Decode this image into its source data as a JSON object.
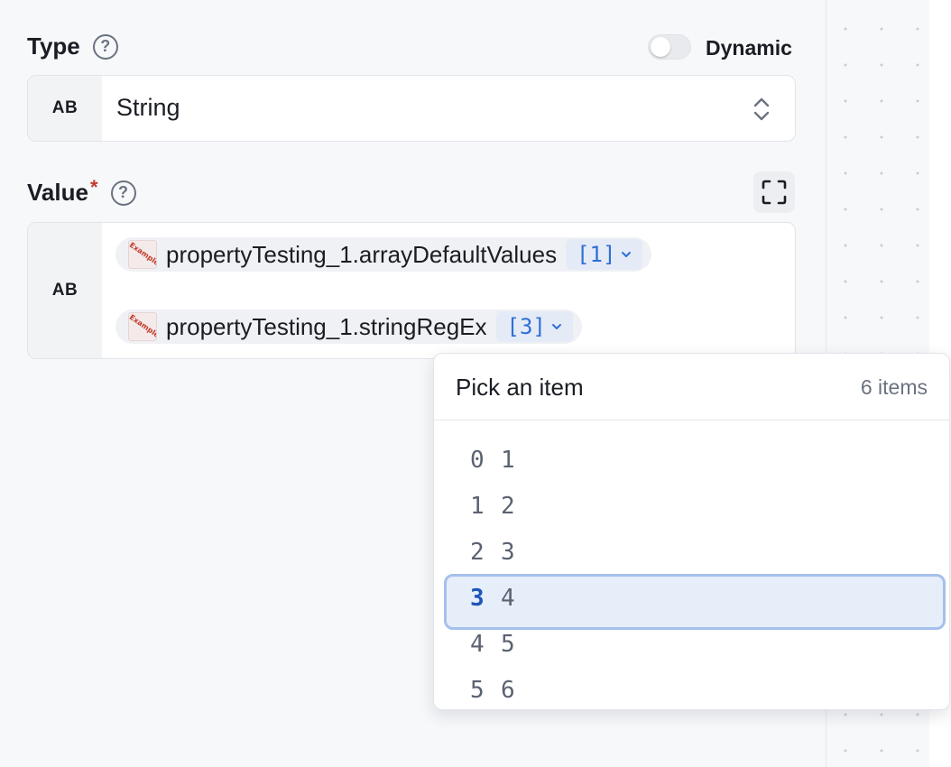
{
  "type_field": {
    "label": "Type",
    "dynamic_label": "Dynamic",
    "dynamic_on": false,
    "badge": "AB",
    "selected_value": "String"
  },
  "value_field": {
    "label": "Value",
    "required_mark": "*",
    "badge": "AB",
    "pills": [
      {
        "text": "propertyTesting_1.arrayDefaultValues",
        "index": "[1]"
      },
      {
        "text": "propertyTesting_1.stringRegEx",
        "index": "[3]"
      }
    ]
  },
  "icons": {
    "help": "help-circle-icon",
    "expand": "expand-icon",
    "select_chevron": "chevron-updown-icon",
    "pill_chevron": "chevron-down-icon",
    "thumb_stamp": "Example"
  },
  "dropdown": {
    "title": "Pick an item",
    "count": "6 items",
    "active_index": 3,
    "items": [
      {
        "index": "0",
        "value": "1"
      },
      {
        "index": "1",
        "value": "2"
      },
      {
        "index": "2",
        "value": "3"
      },
      {
        "index": "3",
        "value": "4"
      },
      {
        "index": "4",
        "value": "5"
      },
      {
        "index": "5",
        "value": "6"
      }
    ]
  },
  "colors": {
    "accent": "#2f6fd6",
    "required": "#c0392b",
    "active_border": "#a6c0ec"
  }
}
